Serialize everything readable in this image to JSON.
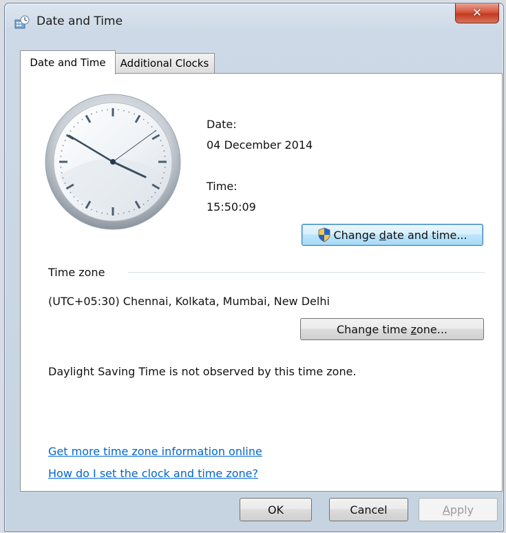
{
  "window": {
    "title": "Date and Time",
    "close_glyph": "✕"
  },
  "tabs": [
    {
      "label": "Date and Time",
      "active": true
    },
    {
      "label": "Additional Clocks",
      "active": false
    }
  ],
  "clock": {
    "hours": 15,
    "minutes": 50,
    "seconds": 9
  },
  "date": {
    "label": "Date:",
    "value": "04 December 2014"
  },
  "time": {
    "label": "Time:",
    "value": "15:50:09"
  },
  "change_datetime_button": {
    "label_pre": "Change ",
    "label_accel": "d",
    "label_post": "ate and time...",
    "icon": "uac-shield-icon"
  },
  "timezone": {
    "section_label": "Time zone",
    "value": "(UTC+05:30) Chennai, Kolkata, Mumbai, New Delhi",
    "change_button": {
      "label_pre": "Change time ",
      "label_accel": "z",
      "label_post": "one..."
    },
    "dst_note": "Daylight Saving Time is not observed by this time zone."
  },
  "links": {
    "more_info": "Get more time zone information online",
    "how_to": "How do I set the clock and time zone?"
  },
  "footer": {
    "ok": "OK",
    "cancel": "Cancel",
    "apply_accel": "A",
    "apply_post": "pply"
  },
  "colors": {
    "link": "#0066cc",
    "close_button": "#c13a1f"
  }
}
